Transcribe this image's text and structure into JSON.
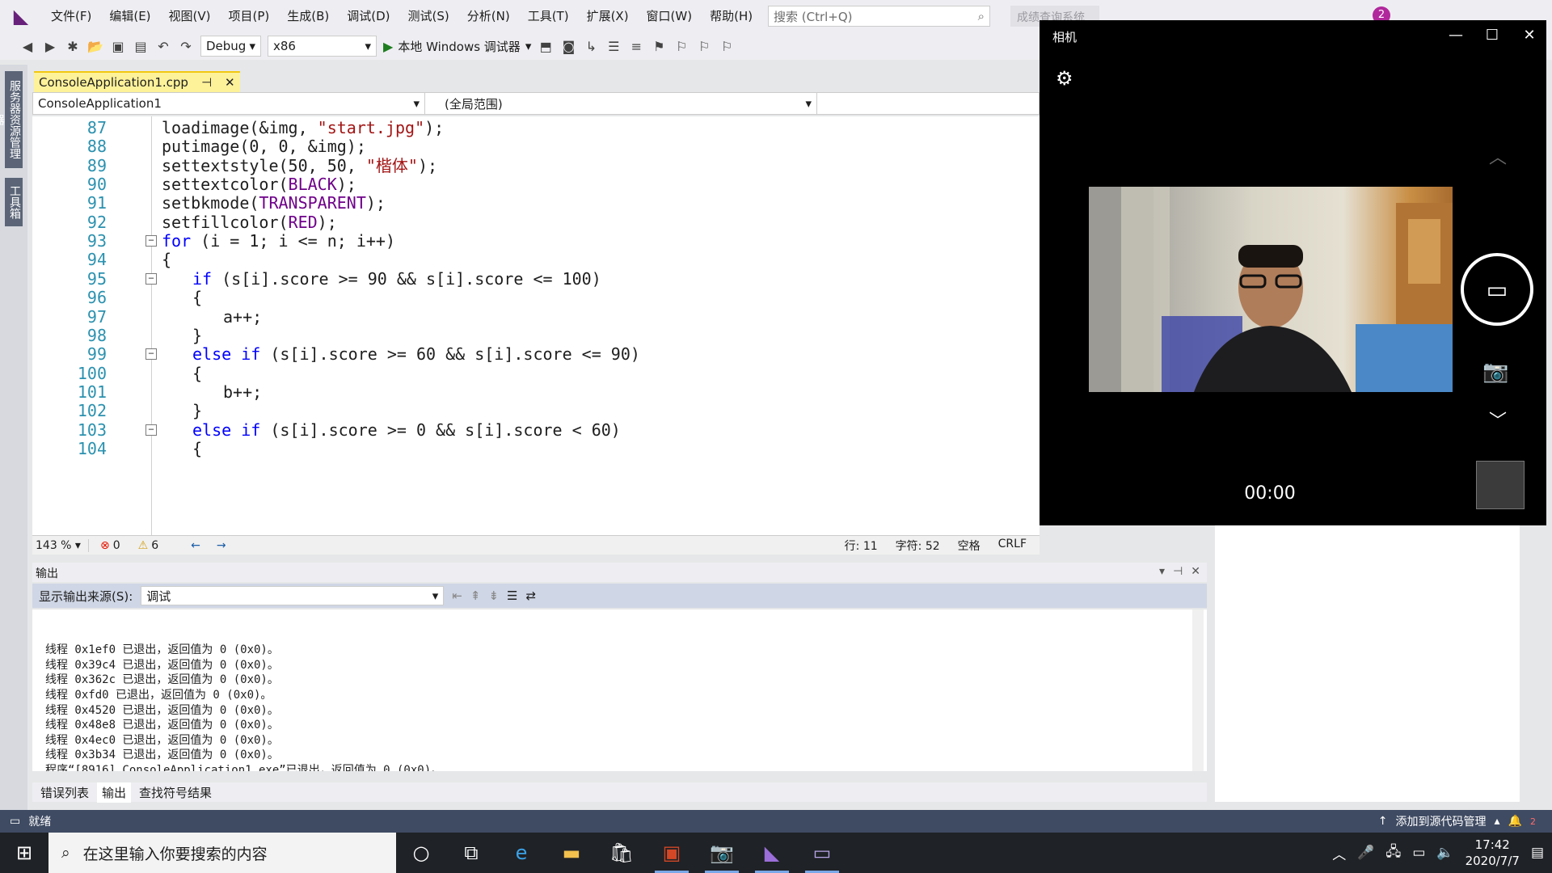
{
  "menubar": {
    "items": [
      "文件(F)",
      "编辑(E)",
      "视图(V)",
      "项目(P)",
      "生成(B)",
      "调试(D)",
      "测试(S)",
      "分析(N)",
      "工具(T)",
      "扩展(X)",
      "窗口(W)",
      "帮助(H)"
    ],
    "search_placeholder": "搜索 (Ctrl+Q)",
    "solution_name": "成绩查询系统",
    "notification_count": "2"
  },
  "toolbar": {
    "config": "Debug",
    "platform": "x86",
    "run_label": "本地 Windows 调试器"
  },
  "left_rail": {
    "tabs": [
      "服务器资源管理器",
      "工具箱"
    ]
  },
  "document": {
    "tab_title": "ConsoleApplication1.cpp",
    "project_dropdown": "ConsoleApplication1",
    "scope_dropdown": "(全局范围)"
  },
  "code_lines": [
    {
      "n": "87",
      "text": "loadimage(&img, \"start.jpg\");"
    },
    {
      "n": "88",
      "text": "putimage(0, 0, &img);"
    },
    {
      "n": "89",
      "text": "settextstyle(50, 50, \"楷体\");"
    },
    {
      "n": "90",
      "text": "settextcolor(BLACK);"
    },
    {
      "n": "91",
      "text": "setbkmode(TRANSPARENT);"
    },
    {
      "n": "92",
      "text": "setfillcolor(RED);"
    },
    {
      "n": "93",
      "text": "for (i = 1; i <= n; i++)"
    },
    {
      "n": "94",
      "text": "{"
    },
    {
      "n": "95",
      "text": "if (s[i].score >= 90 && s[i].score <= 100)"
    },
    {
      "n": "96",
      "text": "{"
    },
    {
      "n": "97",
      "text": "a++;"
    },
    {
      "n": "98",
      "text": "}"
    },
    {
      "n": "99",
      "text": "else if (s[i].score >= 60 && s[i].score <= 90)"
    },
    {
      "n": "100",
      "text": "{"
    },
    {
      "n": "101",
      "text": "b++;"
    },
    {
      "n": "102",
      "text": "}"
    },
    {
      "n": "103",
      "text": "else if (s[i].score >= 0 && s[i].score < 60)"
    },
    {
      "n": "104",
      "text": "{"
    }
  ],
  "editor_status": {
    "zoom": "143 %",
    "errors": "0",
    "warnings": "6",
    "line": "行: 11",
    "char": "字符: 52",
    "whitespace": "空格",
    "eol": "CRLF"
  },
  "output": {
    "title": "输出",
    "source_label": "显示输出来源(S):",
    "source_value": "调试",
    "lines": [
      "线程 0x1ef0 已退出，返回值为 0 (0x0)。",
      "线程 0x39c4 已退出，返回值为 0 (0x0)。",
      "线程 0x362c 已退出，返回值为 0 (0x0)。",
      "线程 0xfd0 已退出，返回值为 0 (0x0)。",
      "线程 0x4520 已退出，返回值为 0 (0x0)。",
      "线程 0x48e8 已退出，返回值为 0 (0x0)。",
      "线程 0x4ec0 已退出，返回值为 0 (0x0)。",
      "线程 0x3b34 已退出，返回值为 0 (0x0)。",
      "程序“[8916] ConsoleApplication1.exe”已退出，返回值为 0 (0x0)。"
    ],
    "tabs": [
      "错误列表",
      "输出",
      "查找符号结果"
    ]
  },
  "status_bar": {
    "ready": "就绪",
    "source_control": "添加到源代码管理",
    "notif": "2"
  },
  "camera": {
    "title": "相机",
    "timer": "00:00"
  },
  "taskbar": {
    "search_placeholder": "在这里输入你要搜索的内容",
    "time": "17:42",
    "date": "2020/7/7"
  },
  "colors": {
    "vs_accent": "#68217a",
    "status_bar": "#3f4b63",
    "tab_active": "#fdf19a",
    "line_number": "#2b91af",
    "keyword": "#0000ff",
    "string": "#a31515",
    "macro": "#6f008a"
  }
}
